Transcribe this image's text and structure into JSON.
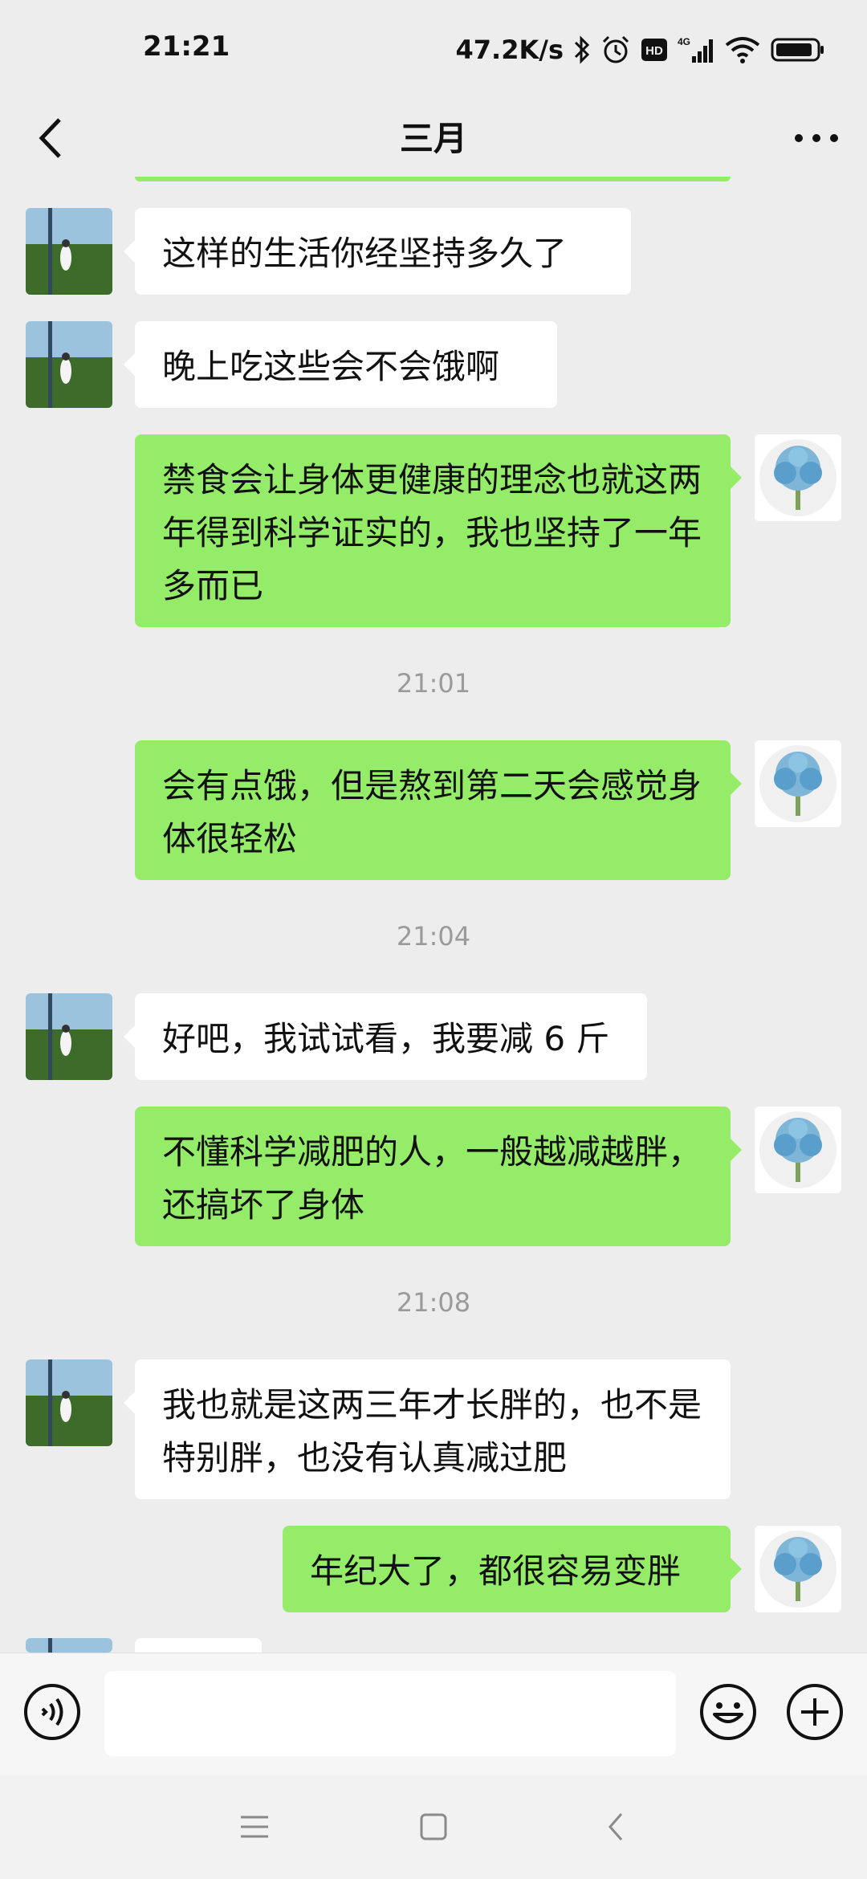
{
  "status_bar": {
    "time": "21:21",
    "network_speed": "47.2K/s",
    "icons": [
      "bluetooth-icon",
      "alarm-icon",
      "hd-icon",
      "signal-4g-icon",
      "wifi-icon",
      "battery-icon"
    ]
  },
  "header": {
    "title": "三月",
    "back_icon": "chevron-left-icon",
    "more_icon": "more-dots-icon"
  },
  "messages": [
    {
      "side": "left",
      "text": "这样的生活你经坚持多久了"
    },
    {
      "side": "left",
      "text": "晚上吃这些会不会饿啊"
    },
    {
      "side": "right",
      "text": "禁食会让身体更健康的理念也就这两年得到科学证实的，我也坚持了一年多而已"
    },
    {
      "side": "timestamp",
      "text": "21:01"
    },
    {
      "side": "right",
      "text": "会有点饿，但是熬到第二天会感觉身体很轻松"
    },
    {
      "side": "timestamp",
      "text": "21:04"
    },
    {
      "side": "left",
      "text": "好吧，我试试看，我要减 6 斤"
    },
    {
      "side": "right",
      "text": "不懂科学减肥的人，一般越减越胖，还搞坏了身体"
    },
    {
      "side": "timestamp",
      "text": "21:08"
    },
    {
      "side": "left",
      "text": "我也就是这两三年才长胖的，也不是特别胖，也没有认真减过肥"
    },
    {
      "side": "right",
      "text": "年纪大了，都很容易变胖"
    }
  ],
  "input_bar": {
    "value": "",
    "voice_icon": "voice-icon",
    "emoji_icon": "emoji-icon",
    "plus_icon": "plus-circle-icon"
  },
  "nav_bar": {
    "icons": [
      "menu-icon",
      "home-square-icon",
      "back-triangle-icon"
    ]
  },
  "colors": {
    "background": "#ededed",
    "bubble_self": "#95ec69",
    "bubble_other": "#ffffff",
    "timestamp": "#9a9a9a"
  }
}
